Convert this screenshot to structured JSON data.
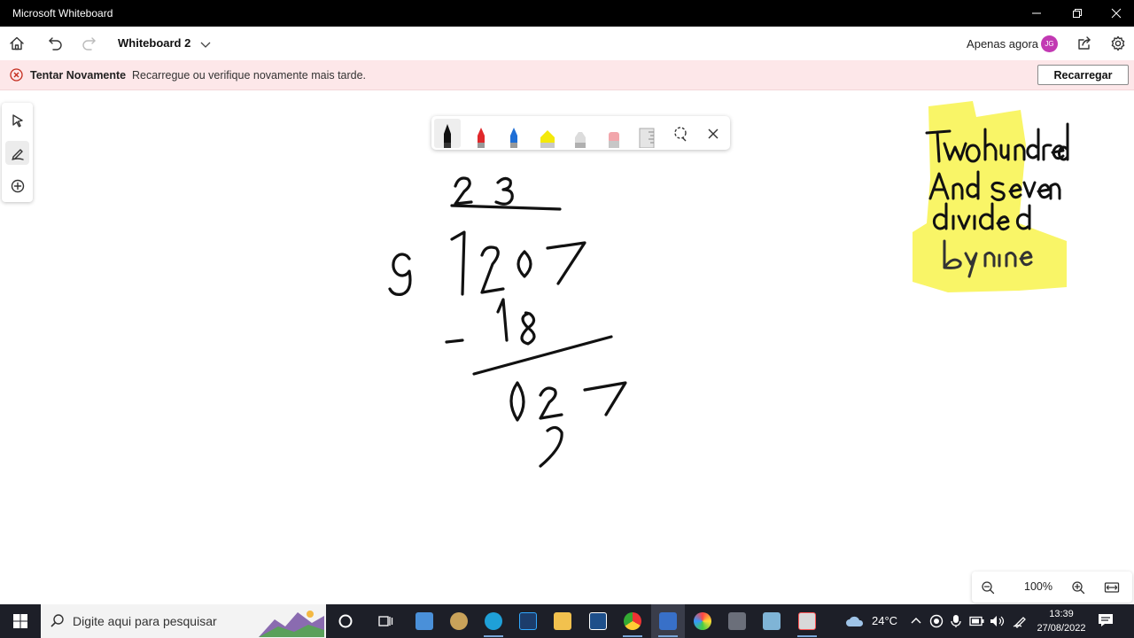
{
  "window": {
    "title": "Microsoft Whiteboard"
  },
  "toolbar": {
    "board_name": "Whiteboard 2",
    "sync_status": "Apenas agora",
    "avatar_initials": "JG"
  },
  "banner": {
    "title": "Tentar Novamente",
    "message": "Recarregue ou verifique novamente mais tarde.",
    "button_label": "Recarregar"
  },
  "ink_tools": [
    {
      "name": "pen-black",
      "color": "#111111"
    },
    {
      "name": "pen-red",
      "color": "#e0282b"
    },
    {
      "name": "pen-blue",
      "color": "#1f6fd6"
    },
    {
      "name": "highlighter-yellow",
      "color": "#f4e90a"
    },
    {
      "name": "eraser",
      "color": "#d9d9d9"
    },
    {
      "name": "eraser-pink",
      "color": "#f2a6ab"
    },
    {
      "name": "ruler",
      "color": "#bdbdbd"
    },
    {
      "name": "lasso-select-icon"
    },
    {
      "name": "close-icon"
    }
  ],
  "canvas": {
    "ink_color": "#111111",
    "highlight_color": "#f7f23c",
    "math_divisor": "9",
    "math_quotient": "23",
    "math_dividend": "207",
    "math_subtrahend": "-18",
    "math_remainder": "027",
    "math_next": "2",
    "note_lines": [
      "Two hundred",
      "And seven",
      "divided",
      "by nine"
    ]
  },
  "zoom": {
    "value": "100%"
  },
  "taskbar": {
    "search_placeholder": "Digite aqui para pesquisar",
    "weather": "24°C",
    "time": "13:39",
    "date": "27/08/2022"
  }
}
